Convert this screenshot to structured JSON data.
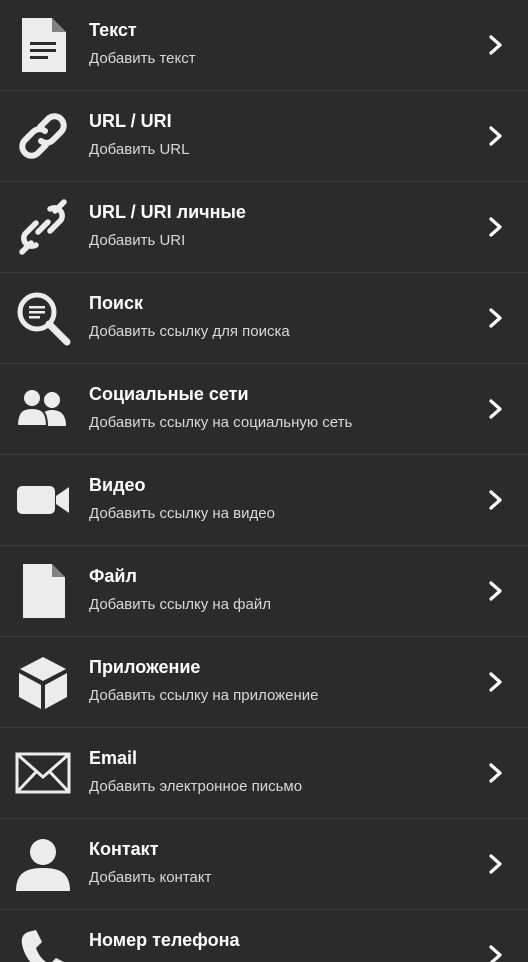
{
  "items": [
    {
      "id": "text",
      "title": "Текст",
      "subtitle": "Добавить текст",
      "icon": "document-text-icon"
    },
    {
      "id": "url",
      "title": "URL / URI",
      "subtitle": "Добавить URL",
      "icon": "link-icon"
    },
    {
      "id": "url-custom",
      "title": "URL / URI личные",
      "subtitle": "Добавить URI",
      "icon": "link-diagonal-icon"
    },
    {
      "id": "search",
      "title": "Поиск",
      "subtitle": "Добавить ссылку для поиска",
      "icon": "search-icon"
    },
    {
      "id": "social",
      "title": "Социальные сети",
      "subtitle": "Добавить ссылку на социальную сеть",
      "icon": "people-icon"
    },
    {
      "id": "video",
      "title": "Видео",
      "subtitle": "Добавить ссылку на видео",
      "icon": "video-camera-icon"
    },
    {
      "id": "file",
      "title": "Файл",
      "subtitle": "Добавить ссылку на файл",
      "icon": "file-icon"
    },
    {
      "id": "app",
      "title": "Приложение",
      "subtitle": "Добавить ссылку на приложение",
      "icon": "box-icon"
    },
    {
      "id": "email",
      "title": "Email",
      "subtitle": "Добавить электронное письмо",
      "icon": "envelope-icon"
    },
    {
      "id": "contact",
      "title": "Контакт",
      "subtitle": "Добавить контакт",
      "icon": "person-icon"
    },
    {
      "id": "phone",
      "title": "Номер телефона",
      "subtitle": "",
      "icon": "phone-icon"
    }
  ],
  "colors": {
    "background": "#2b2b2b",
    "divider": "#3e3e3e",
    "icon": "#ececec",
    "title": "#ffffff",
    "subtitle": "#d8d8d8"
  }
}
